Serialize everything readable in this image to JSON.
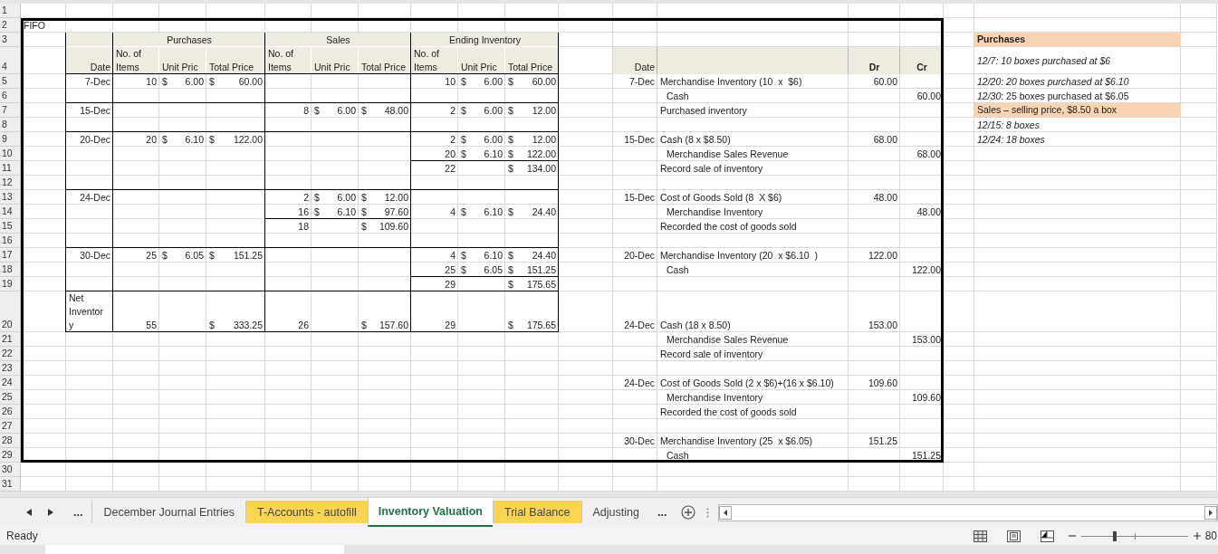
{
  "sheet": {
    "rows": [
      {
        "number": "1"
      },
      {
        "number": "2",
        "title": "FIFO"
      },
      {
        "number": "3",
        "inventory_groups": [
          "Purchases",
          "Sales",
          "Ending Inventory"
        ],
        "note": {
          "kind": "heading",
          "text": "Purchases"
        }
      },
      {
        "number": "4",
        "inventory_header": [
          "Date",
          "No. of Items",
          "Unit Pric",
          "Total Price",
          "No. of Items",
          "Unit Pric",
          "Total Price",
          "No. of Items",
          "Unit Pric",
          "Total Price"
        ],
        "journal_header": {
          "date": "Date",
          "dr": "Dr",
          "cr": "Cr"
        },
        "note": {
          "kind": "note",
          "text": "12/7: 10 boxes purchased at $6"
        }
      },
      {
        "number": "5",
        "inventory": {
          "kind": "entry",
          "date": "7-Dec",
          "purchases": {
            "items": "10",
            "unit": "$ 6.00",
            "total": "$ 60.00"
          },
          "ending": {
            "items": "10",
            "unit": "$ 6.00",
            "total": "$ 60.00",
            "subtotal": false
          }
        },
        "journal": {
          "kind": "debit",
          "date": "7-Dec",
          "account": "Merchandise Inventory (10  x  $6)",
          "dr": "60.00"
        },
        "note": {
          "kind": "note",
          "text": "12/20: 20 boxes purchased at $6.10"
        }
      },
      {
        "number": "6",
        "journal": {
          "kind": "credit",
          "account": "Cash",
          "cr": "60.00"
        },
        "note": {
          "kind": "plain",
          "text": "*12/30*: 25 boxes purchased at $6.05"
        }
      },
      {
        "number": "7",
        "inventory": {
          "kind": "entry",
          "date": "15-Dec",
          "sales": {
            "items": "8",
            "unit": "$ 6.00",
            "total": "$ 48.00",
            "subtotal": false
          },
          "ending": {
            "items": "2",
            "unit": "$ 6.00",
            "total": "$ 12.00",
            "subtotal": false
          }
        },
        "journal": {
          "kind": "memo",
          "account": "Purchased inventory"
        },
        "note": {
          "kind": "highlight",
          "text": "Sales – selling price, $8.50 a box"
        }
      },
      {
        "number": "8",
        "note": {
          "kind": "note",
          "text": "12/15: 8 boxes"
        }
      },
      {
        "number": "9",
        "inventory": {
          "kind": "entry",
          "date": "20-Dec",
          "purchases": {
            "items": "20",
            "unit": "$ 6.10",
            "total": "$ 122.00"
          },
          "ending": {
            "items": "2",
            "unit": "$ 6.00",
            "total": "$ 12.00",
            "subtotal": false
          }
        },
        "journal": {
          "kind": "debit",
          "date": "15-Dec",
          "account": "Cash (8 x $8.50)",
          "dr": "68.00"
        },
        "note": {
          "kind": "note",
          "text": "12/24: 18 boxes"
        }
      },
      {
        "number": "10",
        "inventory": {
          "kind": "line",
          "ending": {
            "items": "20",
            "unit": "$ 6.10",
            "total": "$ 122.00",
            "subtotal": false
          }
        },
        "journal": {
          "kind": "credit",
          "account": "Merchandise Sales Revenue",
          "cr": "68.00"
        }
      },
      {
        "number": "11",
        "inventory": {
          "kind": "line",
          "ending": {
            "items": "22",
            "total": "$ 134.00",
            "subtotal": true
          }
        },
        "journal": {
          "kind": "memo",
          "account": "Record sale of inventory"
        }
      },
      {
        "number": "12"
      },
      {
        "number": "13",
        "inventory": {
          "kind": "entry",
          "date": "24-Dec",
          "sales": {
            "items": "2",
            "unit": "$ 6.00",
            "total": "$ 12.00",
            "subtotal": false
          }
        },
        "journal": {
          "kind": "debit",
          "date": "15-Dec",
          "account": "Cost of Goods Sold (8  X $6)",
          "dr": "48.00"
        }
      },
      {
        "number": "14",
        "inventory": {
          "kind": "line",
          "sales": {
            "items": "16",
            "unit": "$ 6.10",
            "total": "$ 97.60",
            "subtotal": false
          },
          "ending": {
            "items": "4",
            "unit": "$ 6.10",
            "total": "$ 24.40",
            "subtotal": false
          }
        },
        "journal": {
          "kind": "credit",
          "account": "Merchandise Inventory",
          "cr": "48.00"
        }
      },
      {
        "number": "15",
        "inventory": {
          "kind": "line",
          "sales": {
            "items": "18",
            "total": "$ 109.60",
            "subtotal": true
          }
        },
        "journal": {
          "kind": "memo",
          "account": "Recorded the cost of goods sold"
        }
      },
      {
        "number": "16"
      },
      {
        "number": "17",
        "inventory": {
          "kind": "entry",
          "date": "30-Dec",
          "purchases": {
            "items": "25",
            "unit": "$ 6.05",
            "total": "$ 151.25"
          },
          "ending": {
            "items": "4",
            "unit": "$ 6.10",
            "total": "$ 24.40",
            "subtotal": false
          }
        },
        "journal": {
          "kind": "debit",
          "date": "20-Dec",
          "account": "Merchandise Inventory (20  x $6.10  )",
          "dr": "122.00"
        }
      },
      {
        "number": "18",
        "inventory": {
          "kind": "line",
          "ending": {
            "items": "25",
            "unit": "$ 6.05",
            "total": "$ 151.25",
            "subtotal": false
          }
        },
        "journal": {
          "kind": "credit",
          "account": "Cash",
          "cr": "122.00"
        }
      },
      {
        "number": "19",
        "inventory": {
          "kind": "line",
          "ending": {
            "items": "29",
            "total": "$ 175.65",
            "subtotal": true
          }
        }
      },
      {
        "number": "20",
        "inventory": {
          "kind": "total",
          "date": "Net Inventory",
          "purchases": {
            "items": "55",
            "total": "$ 333.25"
          },
          "sales": {
            "items": "26",
            "total": "$ 157.60",
            "subtotal": false
          },
          "ending": {
            "items": "29",
            "total": "$ 175.65",
            "subtotal": false
          }
        },
        "journal": {
          "kind": "debit",
          "date": "24-Dec",
          "account": "Cash (18 x 8.50)",
          "dr": "153.00"
        }
      },
      {
        "number": "21",
        "journal": {
          "kind": "credit",
          "account": "Merchandise Sales Revenue",
          "cr": "153.00"
        }
      },
      {
        "number": "22",
        "journal": {
          "kind": "memo",
          "account": "Record sale of inventory"
        }
      },
      {
        "number": "23"
      },
      {
        "number": "24",
        "journal": {
          "kind": "debit",
          "date": "24-Dec",
          "account": "Cost of Goods Sold (2 x $6)+(16 x $6.10)",
          "dr": "109.60"
        }
      },
      {
        "number": "25",
        "journal": {
          "kind": "credit",
          "account": "Merchandise Inventory",
          "cr": "109.60"
        }
      },
      {
        "number": "26",
        "journal": {
          "kind": "memo",
          "account": "Recorded the cost of goods sold"
        }
      },
      {
        "number": "27"
      },
      {
        "number": "28",
        "journal": {
          "kind": "debit",
          "date": "30-Dec",
          "account": "Merchandise Inventory (25  x $6.05)",
          "dr": "151.25"
        }
      },
      {
        "number": "29",
        "journal": {
          "kind": "credit",
          "account": "Cash",
          "cr": "151.25"
        }
      },
      {
        "number": "30"
      },
      {
        "number": "31"
      }
    ]
  },
  "tab_bar": {
    "more_left": "...",
    "tabs": [
      {
        "label": "December Journal Entries",
        "selected": false
      },
      {
        "label": "T-Accounts - autofill",
        "selected": false,
        "color": "#fbd452"
      },
      {
        "label": "Inventory Valuation",
        "selected": true
      },
      {
        "label": "Trial Balance",
        "selected": false,
        "color": "#fbd452"
      },
      {
        "label": "Adjusting",
        "selected": false
      }
    ],
    "more_right": "..."
  },
  "status_bar": {
    "status": "Ready",
    "zoom_slider": {
      "level": 0.32
    },
    "zoom": "80"
  }
}
